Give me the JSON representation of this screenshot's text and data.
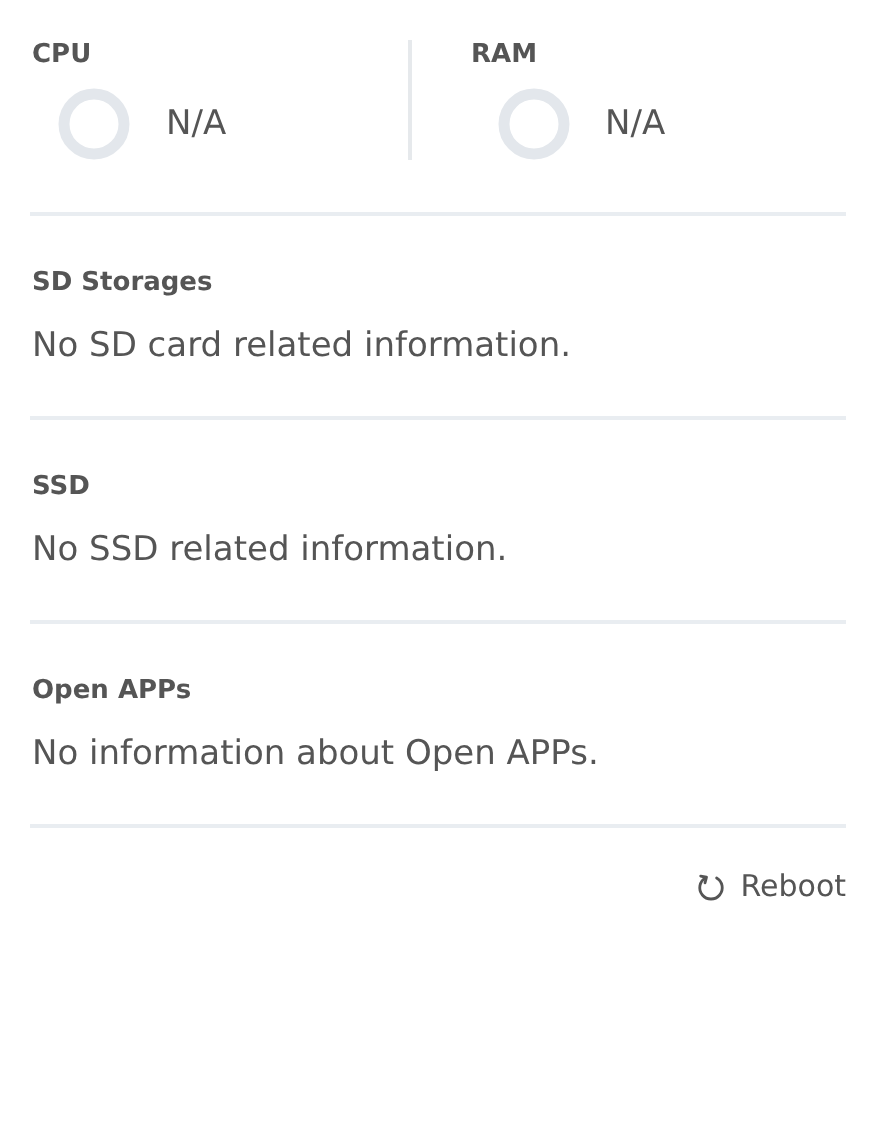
{
  "metrics": [
    {
      "label": "CPU",
      "value": "N/A"
    },
    {
      "label": "RAM",
      "value": "N/A"
    }
  ],
  "sections": [
    {
      "title": "SD Storages",
      "text": "No SD card related information."
    },
    {
      "title": "SSD",
      "text": "No SSD related information."
    },
    {
      "title": "Open APPs",
      "text": "No information about Open APPs."
    }
  ],
  "reboot_button": {
    "label": "Reboot"
  }
}
